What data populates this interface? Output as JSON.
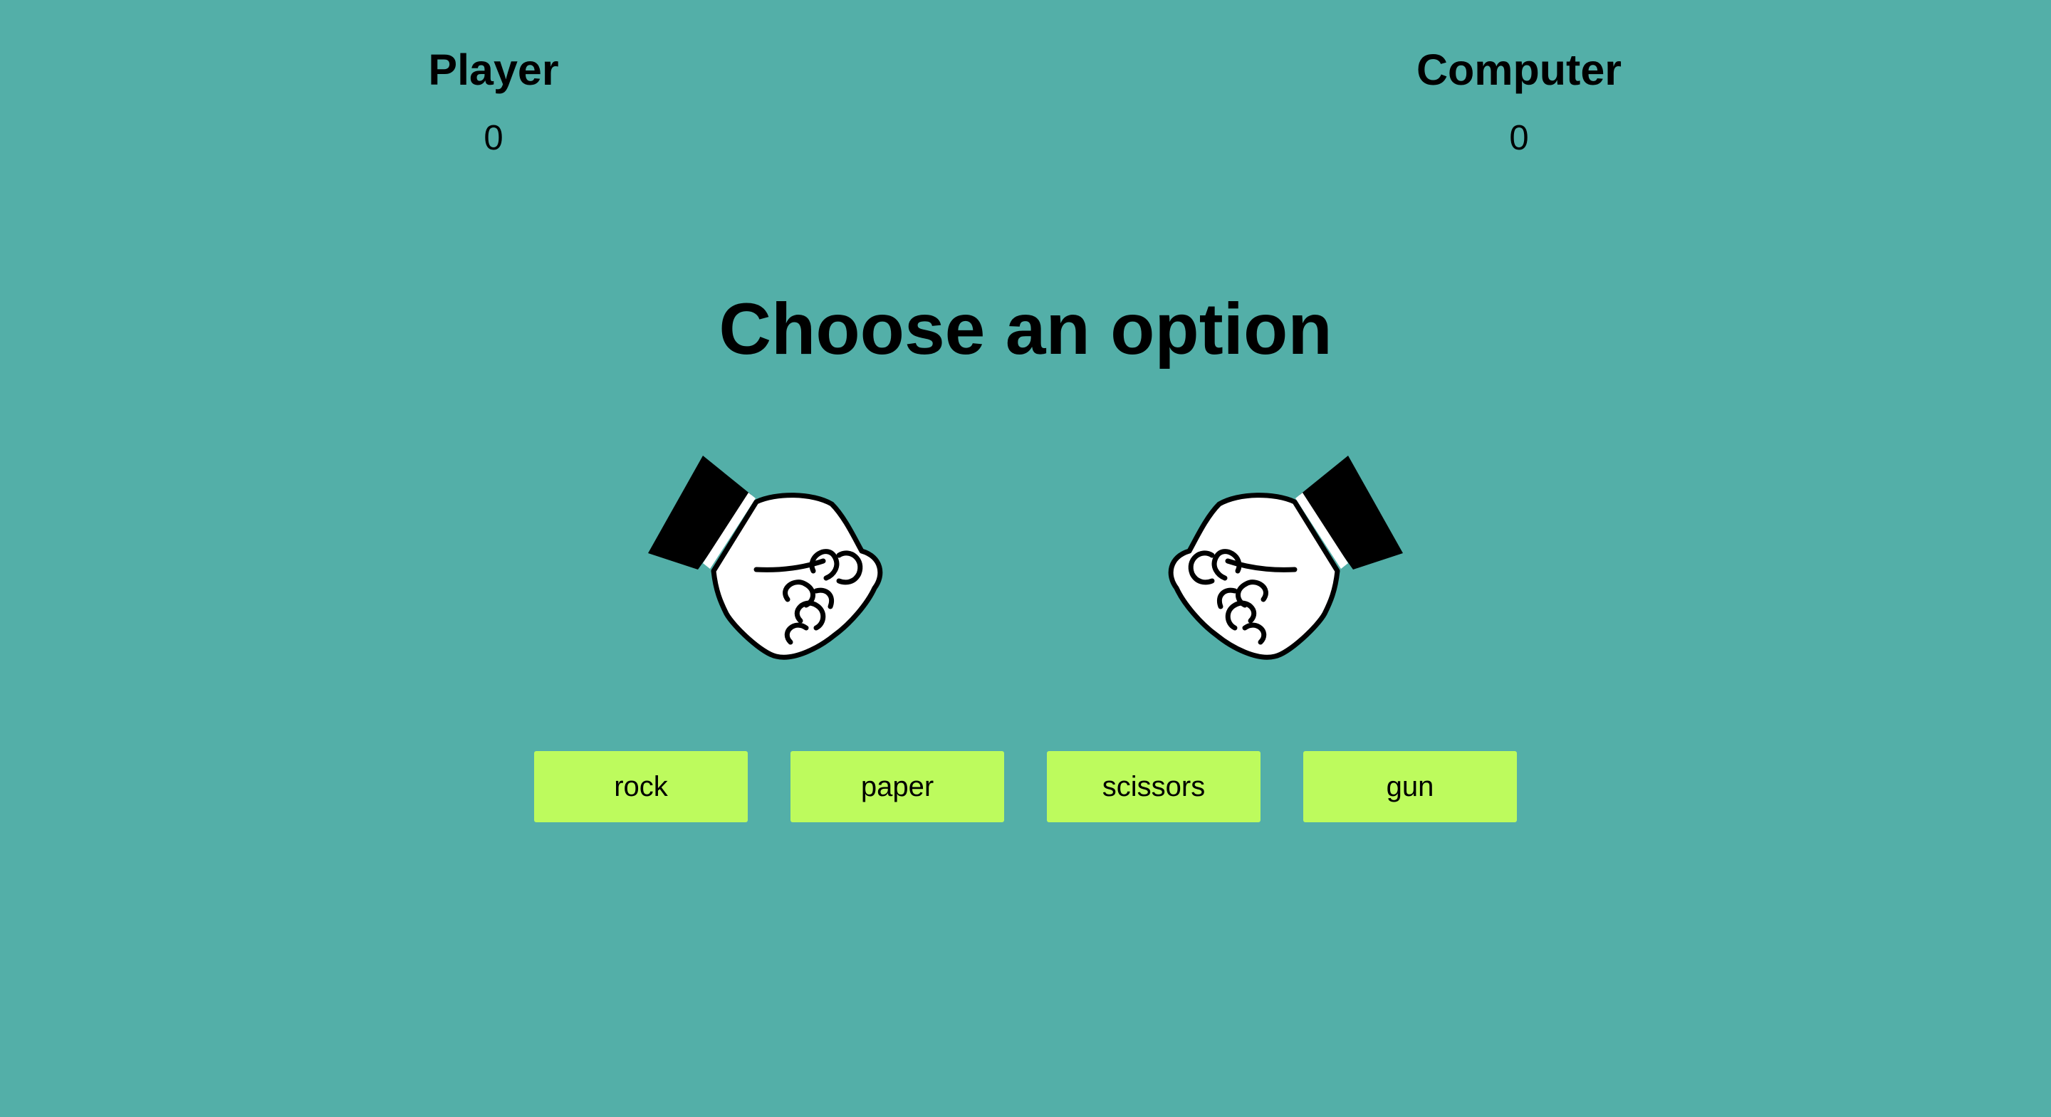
{
  "scoreboard": {
    "player": {
      "label": "Player",
      "score": "0"
    },
    "computer": {
      "label": "Computer",
      "score": "0"
    }
  },
  "prompt": "Choose an option",
  "hands": {
    "player": {
      "icon": "fist-icon",
      "facing": "right"
    },
    "computer": {
      "icon": "fist-icon",
      "facing": "left"
    }
  },
  "choices": [
    {
      "label": "rock"
    },
    {
      "label": "paper"
    },
    {
      "label": "scissors"
    },
    {
      "label": "gun"
    }
  ],
  "colors": {
    "background": "#53afa8",
    "button": "#bdfb5d",
    "text": "#000000"
  }
}
